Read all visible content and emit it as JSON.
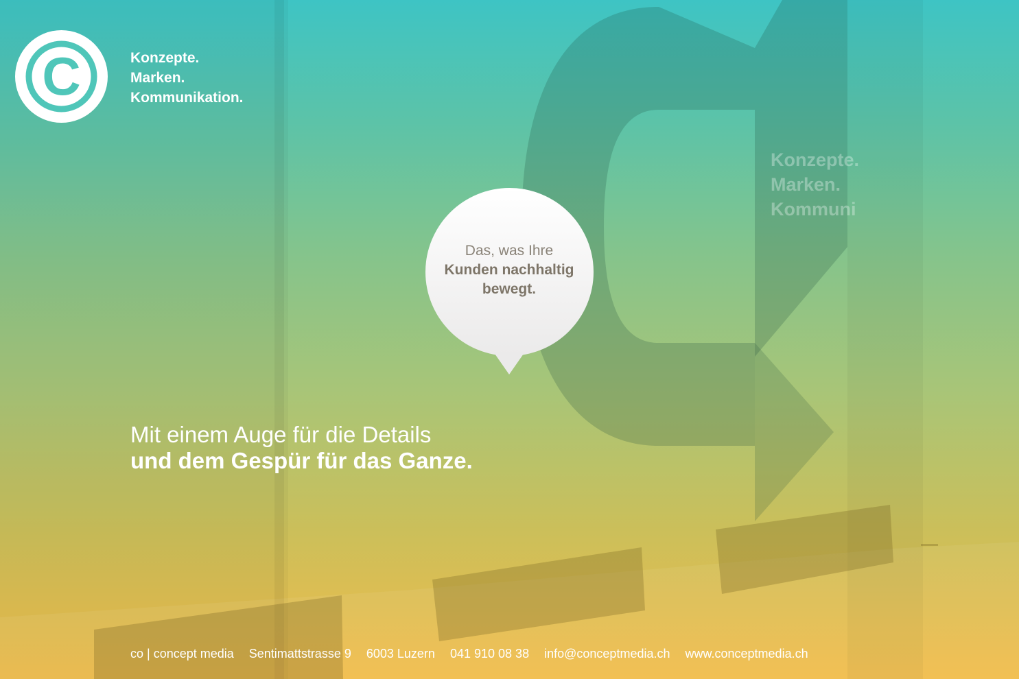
{
  "brand": {
    "logo_icon": "copyright-c-icon",
    "tagline": [
      "Konzepte.",
      "Marken.",
      "Kommunikation."
    ],
    "sign_text": [
      "Konzepte.",
      "Marken.",
      "Kommuni"
    ]
  },
  "bubble": {
    "line1": "Das, was Ihre",
    "line2": "Kunden nachhaltig",
    "line3": "bewegt."
  },
  "headline": {
    "line1": "Mit einem Auge für die Details",
    "line2": "und dem Gespür für das Ganze."
  },
  "footer": {
    "company": "co | concept media",
    "street": "Sentimattstrasse 9",
    "city": "6003 Luzern",
    "phone": "041 910 08 38",
    "email": "info@conceptmedia.ch",
    "website": "www.conceptmedia.ch"
  },
  "colors": {
    "gradient_top": "#3ec4c4",
    "gradient_bottom": "#f2bd4a",
    "text": "#ffffff",
    "bubble_text": "#7d7568"
  }
}
